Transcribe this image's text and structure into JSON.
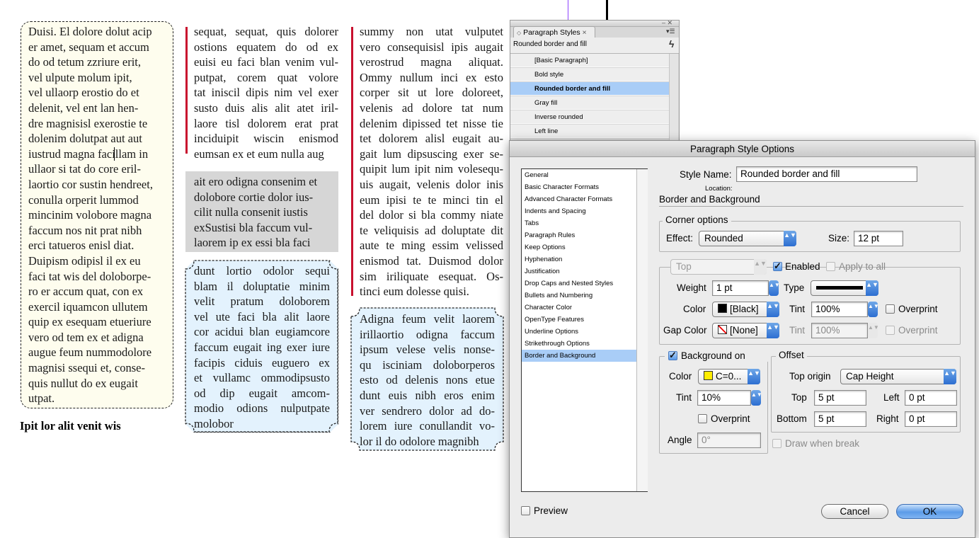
{
  "column1": {
    "lines": [
      "Duisi. El dolore dolut acip",
      "er amet, sequam et accum",
      "do od tetum zzriure erit,",
      "vel ulpute molum ipit,",
      "vel ullaorp erostio do et",
      "delenit, vel ent lan hen-",
      "dre magnisisl exerostie te",
      "dolenim dolutpat aut aut",
      "iustrud magna facillam in",
      "ullaor si tat do core eril-",
      "laortio cor sustin hendreet,",
      "conulla orperit lummod",
      "mincinim volobore magna",
      "faccum nos nit prat nibh",
      "erci tatueros enisl diat.",
      "Duipism odipisl il ex eu",
      "faci tat wis del doloborpe-",
      "ro er accum quat, con ex",
      "exercil iquamcon ullutem",
      "quip ex esequam etueriure",
      "vero od tem ex et adigna",
      "augue feum nummodolore",
      "magnisi ssequi et, conse-",
      "quis nullut do ex eugait",
      "utpat."
    ],
    "heading": "Ipit lor alit venit wis"
  },
  "column2": {
    "block1": [
      "sequat, sequat, quis dolorer",
      "ostions equatem do od ex",
      "euisi eu faci blan venim vul-",
      "putpat, corem quat volore",
      "tat iniscil dipis nim vel exer",
      "susto duis alis alit atet iril-",
      "laore tisl dolorem erat prat",
      "inciduipit wiscin enismod",
      "eumsan ex et eum nulla aug"
    ],
    "block2": [
      "ait ero odigna consenim et",
      "dolobore cortie dolor ius-",
      "cilit nulla consenit iustis",
      "exSustisi bla faccum vul-",
      "laorem ip ex essi bla faci"
    ],
    "block3": [
      "dunt lortio odolor sequi",
      "blam il doluptatie minim",
      "velit pratum doloborem",
      "vel ute faci bla alit laore",
      "cor acidui blan eugiamcore",
      "faccum eugait ing exer iure",
      "facipis ciduis euguero ex",
      "et vullamc ommodipsusto",
      "od dip eugait amcom-",
      "modio odions nulputpate",
      "molobor"
    ]
  },
  "column3": {
    "block1": [
      "summy non utat vulputet",
      "vero consequisisl ipis augait",
      "verostrud magna aliquat.",
      "Ommy nullum inci ex esto",
      "corper sit ut lore doloreet,",
      "velenis ad dolore tat num",
      "delenim dipissed tet nisse tie",
      "tet dolorem alisl eugait au-",
      "gait lum dipsuscing exer se-",
      "quipit lum ipit nim volesequ-",
      "uis augait, velenis dolor inis",
      "eum ipisi te te minci tin el",
      "del dolor si bla commy niate",
      "te veliquisis ad doluptate dit",
      "aute te ming essim velissed",
      "enismod tat. Duismod dolor",
      "sim iriliquate esequat. Os-",
      "tinci eum dolesse quisi."
    ],
    "block2": [
      "Adigna feum velit laorem",
      "irillaortio odigna faccum",
      "ipsum velese velis nonse-",
      "qu isciniam doloborperos",
      "esto od delenis nons etue",
      "dunt euis nibh eros enim",
      "ver sendrero dolor ad do-",
      "lorem iure conullandit vo-",
      "lor il do odolore magnibh"
    ]
  },
  "styles_panel": {
    "tab_label": "Paragraph Styles",
    "tab_close": "×",
    "current_style": "Rounded border and fill",
    "menu_glyph": "▾☰",
    "lightning": "ϟ",
    "items": [
      "[Basic Paragraph]",
      "Bold style",
      "Rounded border and fill",
      "Gray fill",
      "Inverse rounded",
      "Left line"
    ]
  },
  "dialog": {
    "title": "Paragraph Style Options",
    "categories": [
      "General",
      "Basic Character Formats",
      "Advanced Character Formats",
      "Indents and Spacing",
      "Tabs",
      "Paragraph Rules",
      "Keep Options",
      "Hyphenation",
      "Justification",
      "Drop Caps and Nested Styles",
      "Bullets and Numbering",
      "Character Color",
      "OpenType Features",
      "Underline Options",
      "Strikethrough Options",
      "Border and Background"
    ],
    "style_name_label": "Style Name:",
    "style_name_value": "Rounded border and fill",
    "location_label": "Location:",
    "section_title": "Border and Background",
    "corner_options": {
      "title": "Corner options",
      "effect_label": "Effect:",
      "effect_value": "Rounded",
      "size_label": "Size:",
      "size_value": "12 pt"
    },
    "border": {
      "side_value": "Top",
      "enabled_label": "Enabled",
      "apply_all_label": "Apply to all",
      "weight_label": "Weight",
      "weight_value": "1 pt",
      "type_label": "Type",
      "color_label": "Color",
      "color_value": "[Black]",
      "tint_label": "Tint",
      "tint_value": "100%",
      "overprint_label": "Overprint",
      "gap_color_label": "Gap Color",
      "gap_color_value": "[None]",
      "gap_tint_label": "Tint",
      "gap_tint_value": "100%",
      "gap_overprint_label": "Overprint"
    },
    "background": {
      "title": "Background on",
      "color_label": "Color",
      "color_value": "C=0...",
      "tint_label": "Tint",
      "tint_value": "10%",
      "overprint_label": "Overprint",
      "angle_label": "Angle",
      "angle_value": "0°"
    },
    "offset": {
      "title": "Offset",
      "top_origin_label": "Top origin",
      "top_origin_value": "Cap Height",
      "top_label": "Top",
      "top_value": "5 pt",
      "left_label": "Left",
      "left_value": "0 pt",
      "bottom_label": "Bottom",
      "bottom_value": "5 pt",
      "right_label": "Right",
      "right_value": "0 pt"
    },
    "draw_when_break_label": "Draw when break",
    "preview_label": "Preview",
    "cancel_label": "Cancel",
    "ok_label": "OK",
    "arrows_glyph": "▲▼"
  },
  "colors": {
    "accent_red": "#c8102e",
    "selection_blue": "#a9cdf7",
    "col1_fill": "#fefdee",
    "col2_gray": "#d6d6d6",
    "col_blue_fill": "#e3f2fd"
  }
}
